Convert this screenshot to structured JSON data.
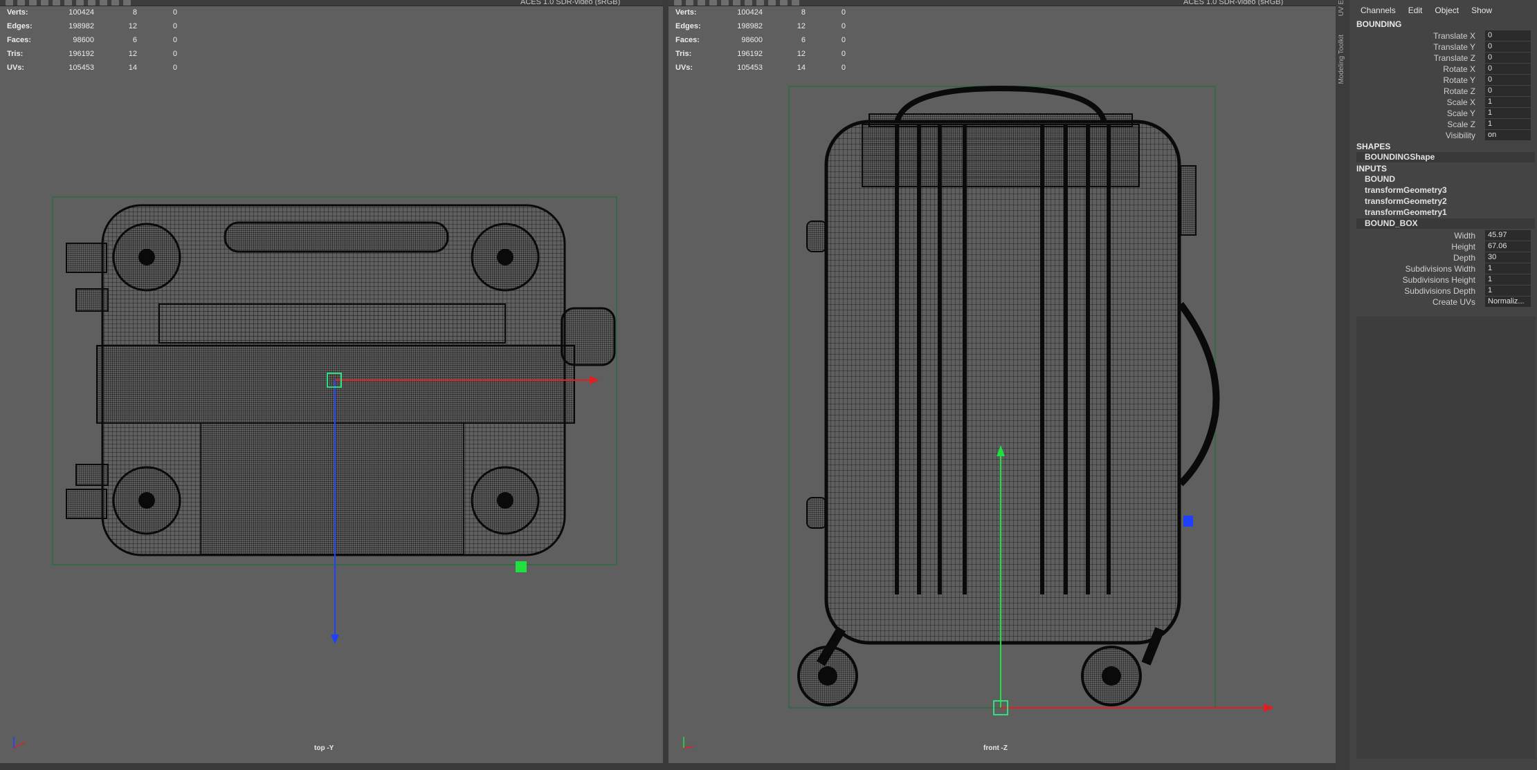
{
  "stats": {
    "rows": [
      {
        "label": "Verts:",
        "total": "100424",
        "selected": "8",
        "components": "0"
      },
      {
        "label": "Edges:",
        "total": "198982",
        "selected": "12",
        "components": "0"
      },
      {
        "label": "Faces:",
        "total": "98600",
        "selected": "6",
        "components": "0"
      },
      {
        "label": "Tris:",
        "total": "196192",
        "selected": "12",
        "components": "0"
      },
      {
        "label": "UVs:",
        "total": "105453",
        "selected": "14",
        "components": "0"
      }
    ]
  },
  "viewports": {
    "left": {
      "camera_label": "top -Y",
      "colorspace": "ACES 1.0 SDR-video (sRGB)"
    },
    "right": {
      "camera_label": "front -Z",
      "colorspace": "ACES 1.0 SDR-video (sRGB)"
    }
  },
  "side_tabs": [
    "Modeling Toolkit",
    "UV E"
  ],
  "channel_box": {
    "menu": [
      "Channels",
      "Edit",
      "Object",
      "Show"
    ],
    "node_name": "BOUNDING",
    "transform_attrs": [
      {
        "label": "Translate X",
        "value": "0"
      },
      {
        "label": "Translate Y",
        "value": "0"
      },
      {
        "label": "Translate Z",
        "value": "0"
      },
      {
        "label": "Rotate X",
        "value": "0"
      },
      {
        "label": "Rotate Y",
        "value": "0"
      },
      {
        "label": "Rotate Z",
        "value": "0"
      },
      {
        "label": "Scale X",
        "value": "1"
      },
      {
        "label": "Scale Y",
        "value": "1"
      },
      {
        "label": "Scale Z",
        "value": "1"
      },
      {
        "label": "Visibility",
        "value": "on"
      }
    ],
    "shapes_header": "SHAPES",
    "shapes": [
      "BOUNDINGShape"
    ],
    "inputs_header": "INPUTS",
    "inputs": [
      "BOUND",
      "transformGeometry3",
      "transformGeometry2",
      "transformGeometry1",
      "BOUND_BOX"
    ],
    "box_attrs": [
      {
        "label": "Width",
        "value": "45.97"
      },
      {
        "label": "Height",
        "value": "67.06"
      },
      {
        "label": "Depth",
        "value": "30"
      },
      {
        "label": "Subdivisions Width",
        "value": "1"
      },
      {
        "label": "Subdivisions Height",
        "value": "1"
      },
      {
        "label": "Subdivisions Depth",
        "value": "1"
      },
      {
        "label": "Create UVs",
        "value": "Normaliz..."
      }
    ]
  },
  "colors": {
    "viewport_bg": "#5f5f5f",
    "panel_bg": "#444444",
    "x_axis": "#e02020",
    "y_axis": "#20e040",
    "z_axis": "#2040ff",
    "wireframe": "#111111",
    "bbox_outline": "#2f6a44"
  }
}
